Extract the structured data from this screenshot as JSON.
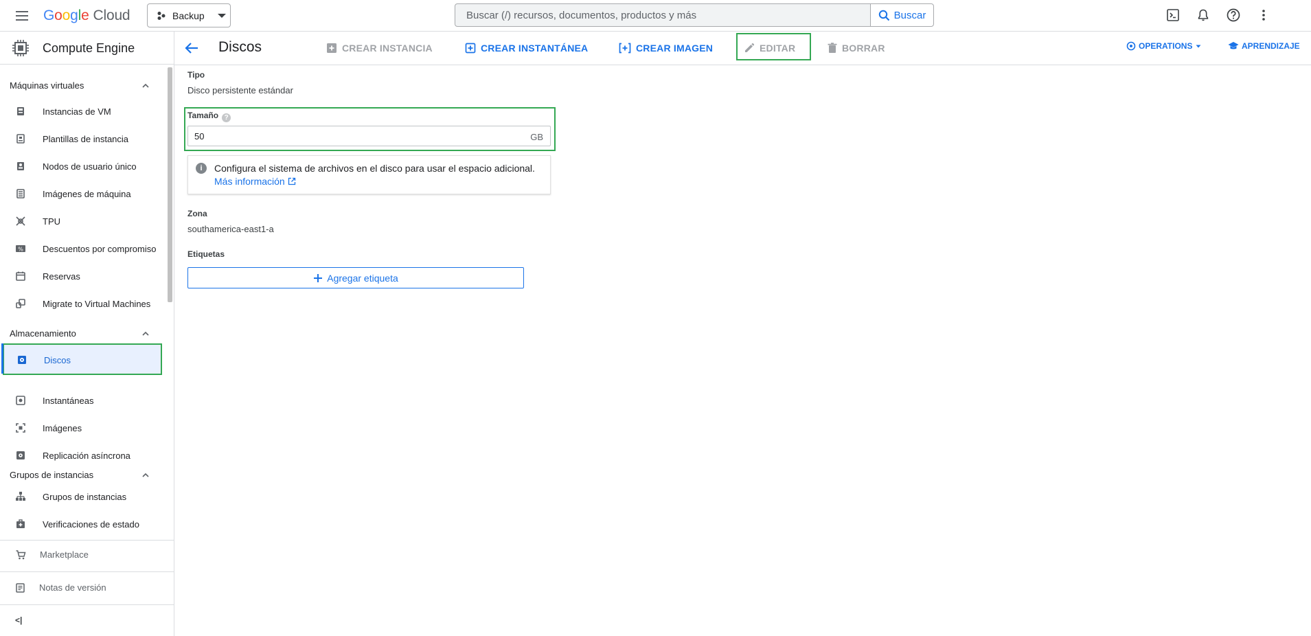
{
  "topbar": {
    "logo_google": "Google",
    "logo_cloud": "Cloud",
    "project": "Backup",
    "search_placeholder": "Buscar (/) recursos, documentos, productos y más",
    "search_button": "Buscar"
  },
  "sidebar": {
    "product": "Compute Engine",
    "sections": [
      {
        "title": "Máquinas virtuales"
      },
      {
        "title": "Almacenamiento"
      },
      {
        "title": "Grupos de instancias"
      }
    ],
    "items": [
      {
        "label": "Instancias de VM"
      },
      {
        "label": "Plantillas de instancia"
      },
      {
        "label": "Nodos de usuario único"
      },
      {
        "label": "Imágenes de máquina"
      },
      {
        "label": "TPU"
      },
      {
        "label": "Descuentos por compromiso"
      },
      {
        "label": "Reservas"
      },
      {
        "label": "Migrate to Virtual Machines"
      },
      {
        "label": "Discos"
      },
      {
        "label": "Instantáneas"
      },
      {
        "label": "Imágenes"
      },
      {
        "label": "Replicación asíncrona"
      },
      {
        "label": "Grupos de instancias"
      },
      {
        "label": "Verificaciones de estado"
      }
    ],
    "marketplace": "Marketplace",
    "release_notes": "Notas de versión",
    "collapse": "<|"
  },
  "actionbar": {
    "title": "Discos",
    "create_instance": "CREAR INSTANCIA",
    "create_snapshot": "CREAR INSTANTÁNEA",
    "create_image": "CREAR IMAGEN",
    "edit": "EDITAR",
    "delete": "BORRAR",
    "operations": "OPERATIONS",
    "learning": "APRENDIZAJE"
  },
  "content": {
    "type_label": "Tipo",
    "type_value": "Disco persistente estándar",
    "size_label": "Tamaño",
    "size_value": "50",
    "size_unit": "GB",
    "info_text": "Configura el sistema de archivos en el disco para usar el espacio adicional.",
    "info_link": "Más información",
    "zone_label": "Zona",
    "zone_value": "southamerica-east1-a",
    "labels_label": "Etiquetas",
    "add_label_button": "Agregar etiqueta"
  },
  "colors": {
    "accent": "#1a73e8",
    "highlight": "#34a853",
    "disabled": "#a0a3a7"
  }
}
